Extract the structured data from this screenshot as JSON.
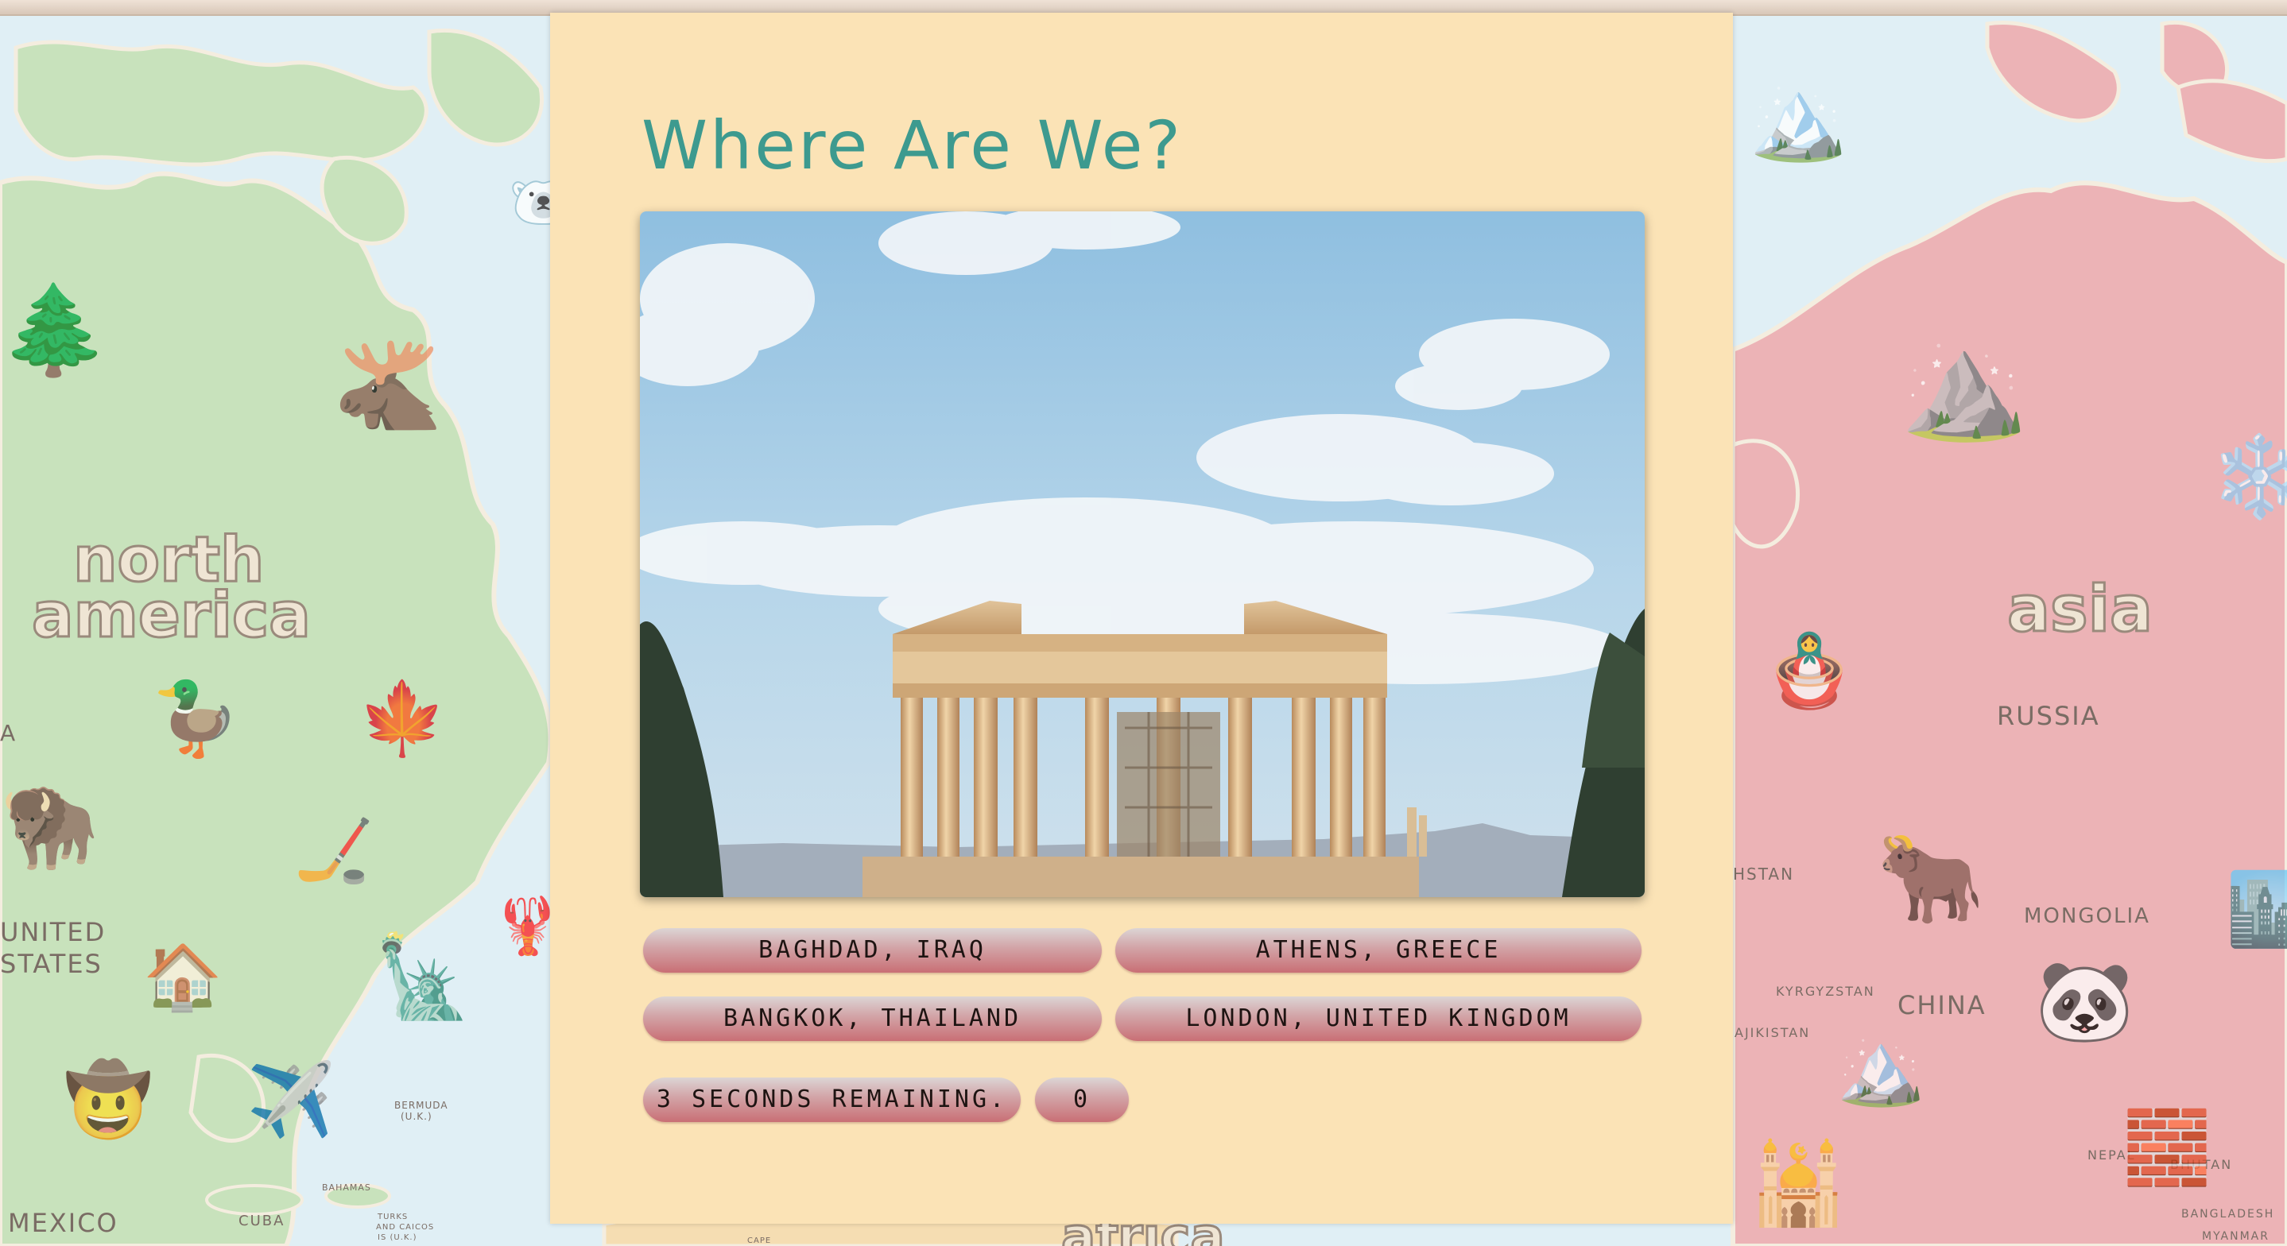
{
  "game": {
    "title": "Where Are We?",
    "options": [
      "Baghdad, Iraq",
      "Athens, Greece",
      "Bangkok, Thailand",
      "London, United Kingdom"
    ],
    "timer_text": "3 seconds remaining.",
    "score": "0"
  },
  "map_labels": {
    "north_america": [
      "north",
      "america"
    ],
    "asia": "asia",
    "africa": "africa",
    "russia": "RUSSIA",
    "mongolia": "MONGOLIA",
    "china": "CHINA",
    "united_states": [
      "UNITED",
      "STATES"
    ],
    "mexico": "MEXICO",
    "cuba": "CUBA",
    "bermuda": [
      "BERMUDA",
      "(U.K.)"
    ],
    "bahamas": "BAHAMAS",
    "kazakhstan_partial": "HSTAN",
    "kyrgyzstan": "KYRGYZSTAN",
    "tajikistan_partial": "AJIKISTAN",
    "nepal": "NEPAL",
    "bhutan": "BHUTAN",
    "bangladesh": "BANGLADESH",
    "myanmar": "MYANMAR",
    "turks_caicos": [
      "TURKS",
      "AND CAICOS",
      "IS (U.K.)"
    ],
    "cape_partial": "CAPE",
    "a_partial": "A"
  },
  "colors": {
    "panel": "#fbe3b6",
    "title": "#3d9a8f",
    "ocean": "#d9ecf3",
    "north_america": "#bcdcae",
    "asia": "#e8a3a6"
  }
}
